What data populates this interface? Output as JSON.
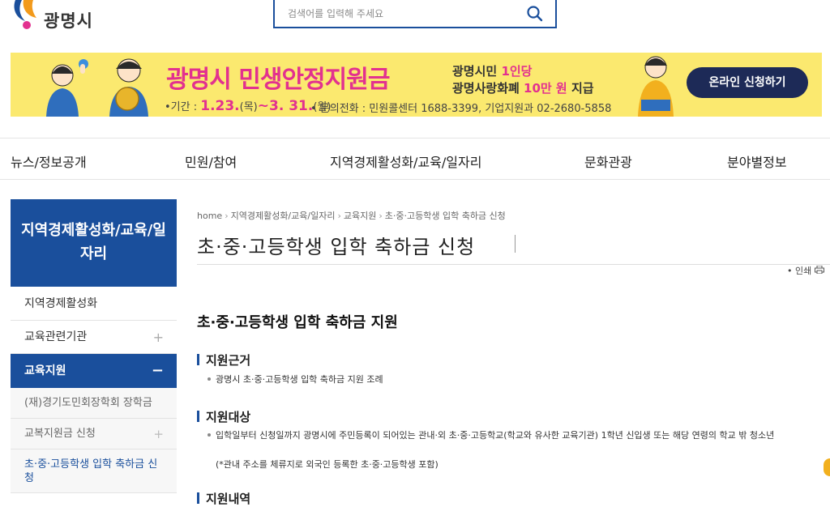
{
  "header": {
    "logo_text": "광명시",
    "search_placeholder": "검색어를 입력해 주세요"
  },
  "banner": {
    "title": "광명시 민생안정지원금",
    "sub1_prefix": "광명시민 ",
    "sub1_highlight": "1인당",
    "sub2_prefix": "광명사랑화폐 ",
    "sub2_highlight": "10만 원",
    "sub2_suffix": " 지급",
    "period_label": "•기간 : ",
    "period_start": "1.23.",
    "period_start_day": "(목)",
    "period_sep": "~",
    "period_end": "3. 31.",
    "period_end_day": "(월)",
    "contact": "• 문의전화 : 민원콜센터 1688-3399, 기업지원과 02-2680-5858",
    "cta": "온라인 신청하기"
  },
  "main_nav": [
    "뉴스/정보공개",
    "민원/참여",
    "지역경제활성화/교육/일자리",
    "문화관광",
    "분야별정보"
  ],
  "side_nav": {
    "heading": "지역경제활성화/교육/일자리",
    "items": [
      {
        "label": "지역경제활성화",
        "sign": ""
      },
      {
        "label": "교육관련기관",
        "sign": "+"
      }
    ],
    "active": {
      "label": "교육지원",
      "sign": "−"
    },
    "sub_items": [
      {
        "label": "(재)경기도민회장학회 장학금",
        "sign": ""
      },
      {
        "label": "교복지원금 신청",
        "sign": "+"
      },
      {
        "label": "초·중·고등학생 입학 축하금 신청",
        "sign": ""
      }
    ]
  },
  "content": {
    "breadcrumb": [
      "home",
      "지역경제활성화/교육/일자리",
      "교육지원",
      "초·중·고등학생 입학 축하금 신청"
    ],
    "page_title": "초·중·고등학생 입학 축하금 신청",
    "print_label": "• 인쇄",
    "section_title": "초·중·고등학생 입학 축하금 지원",
    "subsections": [
      {
        "heading": "지원근거",
        "bullets": [
          "광명시 초·중·고등학생 입학 축하금 지원 조례"
        ]
      },
      {
        "heading": "지원대상",
        "bullets": [
          "입학일부터 신청일까지 광명시에 주민등록이 되어있는 관내·외 초·중·고등학교(학교와 유사한 교육기관) 1학년 신입생 또는 해당 연령의 학교 밖 청소년"
        ],
        "note": "(*관내 주소를 체류지로 외국인 등록한 초·중·고등학생 포함)"
      },
      {
        "heading": "지원내역",
        "bullets": []
      }
    ]
  },
  "colors": {
    "primary": "#1a4f9c",
    "banner_bg": "#fbe96f",
    "banner_accent": "#e2318f",
    "cta_bg": "#1d2a57"
  }
}
